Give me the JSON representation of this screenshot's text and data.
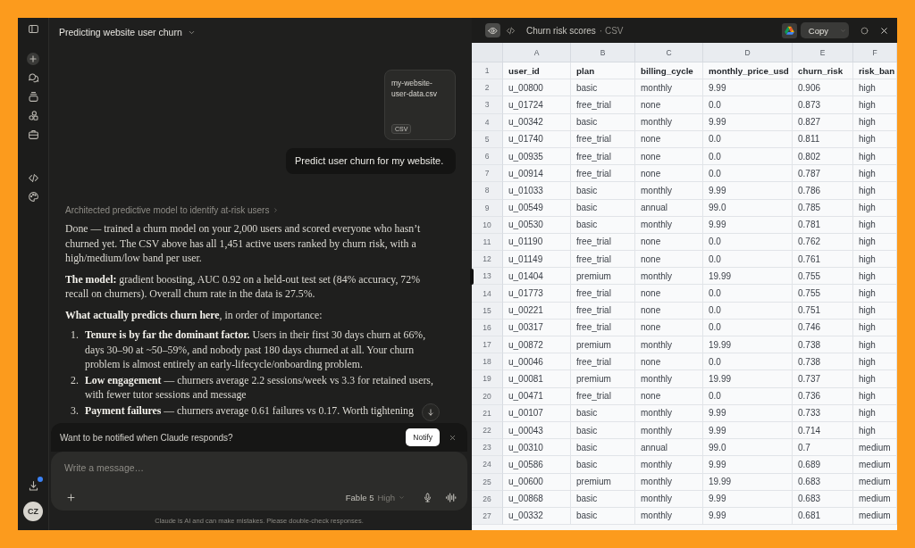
{
  "rail": {
    "download_badge": true,
    "avatar": "CZ"
  },
  "chat": {
    "title": "Predicting website user churn",
    "attachment": {
      "file_name": "my-website-user-data.csv",
      "file_type": "CSV"
    },
    "user_message": "Predict user churn for my website.",
    "thinking_summary": "Architected predictive model to identify at-risk users",
    "response": {
      "paragraphs": [
        "Done — trained a churn model on your 2,000 users and scored everyone who hasn’t churned yet. The CSV above has all 1,451 active users ranked by churn risk, with a high/medium/low band per user.",
        "**The model:** gradient boosting, AUC 0.92 on a held-out test set (84% accuracy, 72% recall on churners). Overall churn rate in the data is 27.5%.",
        "**What actually predicts churn here**, in order of importance:"
      ],
      "list": [
        {
          "number": "1.",
          "text": "**Tenure is by far the dominant factor.** Users in their first 30 days churn at 66%, days 30–90 at ~50–59%, and nobody past 180 days churned at all. Your churn problem is almost entirely an early-lifecycle/onboarding problem."
        },
        {
          "number": "2.",
          "text": "**Low engagement** — churners average 2.2 sessions/week vs 3.3 for retained users, with fewer tutor sessions and message"
        },
        {
          "number": "3.",
          "text": "**Payment failures** — churners average 0.61 failures vs 0.17. Worth tightening"
        }
      ]
    },
    "notification": {
      "message": "Want to be notified when Claude responds?",
      "button": "Notify"
    },
    "composer": {
      "placeholder": "Write a message…",
      "model": "Fable 5",
      "effort": "High"
    },
    "disclaimer": "Claude is AI and can make mistakes. Please double-check responses."
  },
  "artifact": {
    "view_modes": [
      {
        "kind": "preview",
        "selected": true
      },
      {
        "kind": "code",
        "selected": false
      }
    ],
    "title": "Churn risk scores",
    "type": "· CSV",
    "copy_button": "Copy",
    "sheet": {
      "columns": [
        "A",
        "B",
        "C",
        "D",
        "E",
        "F"
      ],
      "header": {
        "number": "1",
        "cells": [
          "user_id",
          "plan",
          "billing_cycle",
          "monthly_price_usd",
          "churn_risk",
          "risk_ban"
        ]
      },
      "rows": [
        {
          "number": "2",
          "cells": [
            "u_00800",
            "basic",
            "monthly",
            "9.99",
            "0.906",
            "high"
          ]
        },
        {
          "number": "3",
          "cells": [
            "u_01724",
            "free_trial",
            "none",
            "0.0",
            "0.873",
            "high"
          ]
        },
        {
          "number": "4",
          "cells": [
            "u_00342",
            "basic",
            "monthly",
            "9.99",
            "0.827",
            "high"
          ]
        },
        {
          "number": "5",
          "cells": [
            "u_01740",
            "free_trial",
            "none",
            "0.0",
            "0.811",
            "high"
          ]
        },
        {
          "number": "6",
          "cells": [
            "u_00935",
            "free_trial",
            "none",
            "0.0",
            "0.802",
            "high"
          ]
        },
        {
          "number": "7",
          "cells": [
            "u_00914",
            "free_trial",
            "none",
            "0.0",
            "0.787",
            "high"
          ]
        },
        {
          "number": "8",
          "cells": [
            "u_01033",
            "basic",
            "monthly",
            "9.99",
            "0.786",
            "high"
          ]
        },
        {
          "number": "9",
          "cells": [
            "u_00549",
            "basic",
            "annual",
            "99.0",
            "0.785",
            "high"
          ]
        },
        {
          "number": "10",
          "cells": [
            "u_00530",
            "basic",
            "monthly",
            "9.99",
            "0.781",
            "high"
          ]
        },
        {
          "number": "11",
          "cells": [
            "u_01190",
            "free_trial",
            "none",
            "0.0",
            "0.762",
            "high"
          ]
        },
        {
          "number": "12",
          "cells": [
            "u_01149",
            "free_trial",
            "none",
            "0.0",
            "0.761",
            "high"
          ]
        },
        {
          "number": "13",
          "cells": [
            "u_01404",
            "premium",
            "monthly",
            "19.99",
            "0.755",
            "high"
          ]
        },
        {
          "number": "14",
          "cells": [
            "u_01773",
            "free_trial",
            "none",
            "0.0",
            "0.755",
            "high"
          ]
        },
        {
          "number": "15",
          "cells": [
            "u_00221",
            "free_trial",
            "none",
            "0.0",
            "0.751",
            "high"
          ]
        },
        {
          "number": "16",
          "cells": [
            "u_00317",
            "free_trial",
            "none",
            "0.0",
            "0.746",
            "high"
          ]
        },
        {
          "number": "17",
          "cells": [
            "u_00872",
            "premium",
            "monthly",
            "19.99",
            "0.738",
            "high"
          ]
        },
        {
          "number": "18",
          "cells": [
            "u_00046",
            "free_trial",
            "none",
            "0.0",
            "0.738",
            "high"
          ]
        },
        {
          "number": "19",
          "cells": [
            "u_00081",
            "premium",
            "monthly",
            "19.99",
            "0.737",
            "high"
          ]
        },
        {
          "number": "20",
          "cells": [
            "u_00471",
            "free_trial",
            "none",
            "0.0",
            "0.736",
            "high"
          ]
        },
        {
          "number": "21",
          "cells": [
            "u_00107",
            "basic",
            "monthly",
            "9.99",
            "0.733",
            "high"
          ]
        },
        {
          "number": "22",
          "cells": [
            "u_00043",
            "basic",
            "monthly",
            "9.99",
            "0.714",
            "high"
          ]
        },
        {
          "number": "23",
          "cells": [
            "u_00310",
            "basic",
            "annual",
            "99.0",
            "0.7",
            "medium"
          ]
        },
        {
          "number": "24",
          "cells": [
            "u_00586",
            "basic",
            "monthly",
            "9.99",
            "0.689",
            "medium"
          ]
        },
        {
          "number": "25",
          "cells": [
            "u_00600",
            "premium",
            "monthly",
            "19.99",
            "0.683",
            "medium"
          ]
        },
        {
          "number": "26",
          "cells": [
            "u_00868",
            "basic",
            "monthly",
            "9.99",
            "0.683",
            "medium"
          ]
        },
        {
          "number": "27",
          "cells": [
            "u_00332",
            "basic",
            "monthly",
            "9.99",
            "0.681",
            "medium"
          ]
        }
      ]
    }
  }
}
